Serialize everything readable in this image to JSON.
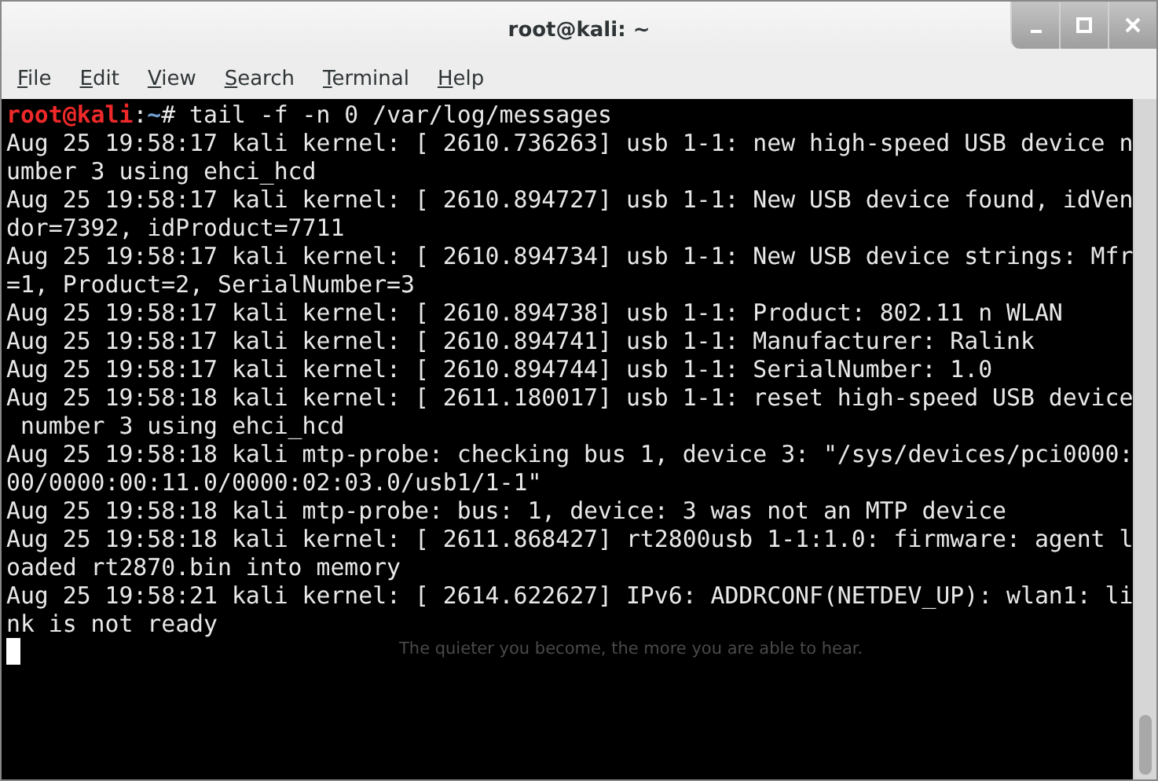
{
  "window": {
    "title": "root@kali: ~"
  },
  "menu": [
    "File",
    "Edit",
    "View",
    "Search",
    "Terminal",
    "Help"
  ],
  "terminal": {
    "lines": [
      {
        "kind": "prompt",
        "parts": [
          {
            "kind": "user",
            "text": "root@kali"
          },
          {
            "kind": "plain",
            "text": ":"
          },
          {
            "kind": "path",
            "text": "~"
          },
          {
            "kind": "plain",
            "text": "# tail -f -n 0 /var/log/messages"
          }
        ]
      },
      {
        "kind": "output",
        "text": "Aug 25 19:58:17 kali kernel: [ 2610.736263] usb 1-1: new high-speed USB device n"
      },
      {
        "kind": "output",
        "text": "umber 3 using ehci_hcd"
      },
      {
        "kind": "output",
        "text": "Aug 25 19:58:17 kali kernel: [ 2610.894727] usb 1-1: New USB device found, idVen"
      },
      {
        "kind": "output",
        "text": "dor=7392, idProduct=7711"
      },
      {
        "kind": "output",
        "text": "Aug 25 19:58:17 kali kernel: [ 2610.894734] usb 1-1: New USB device strings: Mfr"
      },
      {
        "kind": "output",
        "text": "=1, Product=2, SerialNumber=3"
      },
      {
        "kind": "output",
        "text": "Aug 25 19:58:17 kali kernel: [ 2610.894738] usb 1-1: Product: 802.11 n WLAN"
      },
      {
        "kind": "output",
        "text": "Aug 25 19:58:17 kali kernel: [ 2610.894741] usb 1-1: Manufacturer: Ralink"
      },
      {
        "kind": "output",
        "text": "Aug 25 19:58:17 kali kernel: [ 2610.894744] usb 1-1: SerialNumber: 1.0"
      },
      {
        "kind": "output",
        "text": "Aug 25 19:58:18 kali kernel: [ 2611.180017] usb 1-1: reset high-speed USB device"
      },
      {
        "kind": "output",
        "text": " number 3 using ehci_hcd"
      },
      {
        "kind": "output",
        "text": "Aug 25 19:58:18 kali mtp-probe: checking bus 1, device 3: \"/sys/devices/pci0000:"
      },
      {
        "kind": "output",
        "text": "00/0000:00:11.0/0000:02:03.0/usb1/1-1\""
      },
      {
        "kind": "output",
        "text": "Aug 25 19:58:18 kali mtp-probe: bus: 1, device: 3 was not an MTP device"
      },
      {
        "kind": "output",
        "text": "Aug 25 19:58:18 kali kernel: [ 2611.868427] rt2800usb 1-1:1.0: firmware: agent l"
      },
      {
        "kind": "output",
        "text": "oaded rt2870.bin into memory"
      },
      {
        "kind": "output",
        "text": "Aug 25 19:58:21 kali kernel: [ 2614.622627] IPv6: ADDRCONF(NETDEV_UP): wlan1: li"
      },
      {
        "kind": "output",
        "text": "nk is not ready"
      },
      {
        "kind": "cursor"
      }
    ],
    "background_tagline": "The quieter you become, the more you are able to hear."
  }
}
